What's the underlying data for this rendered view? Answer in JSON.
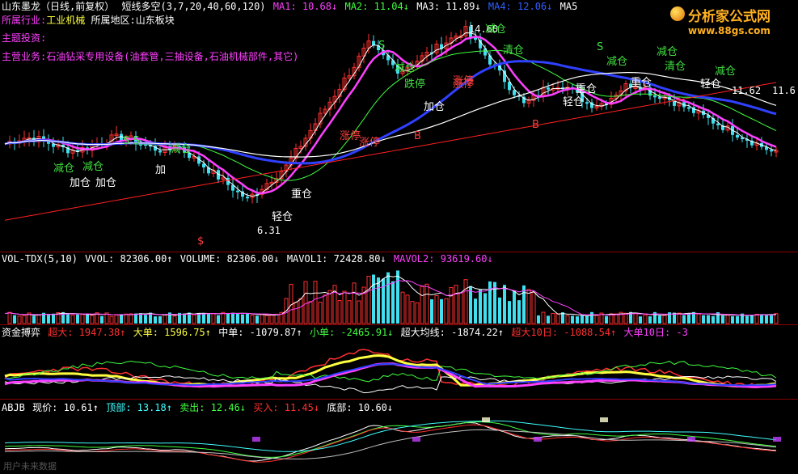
{
  "main_header": {
    "stock": "山东墨龙（日线,前复权）",
    "indicator": "短线多空(3,7,20,40,60,120)",
    "ma1": "MA1: 10.68↓",
    "ma2": "MA2: 11.04↓",
    "ma3": "MA3: 11.89↓",
    "ma4": "MA4: 12.06↓",
    "ma5": "MA5"
  },
  "info_lines": {
    "industry_label": "所属行业:",
    "industry": "工业机械",
    "region_label": "所属地区:",
    "region": "山东板块",
    "theme_label": "主题投资:",
    "business_label": "主营业务:",
    "business": "石油钻采专用设备(油套管,三抽设备,石油机械部件,其它)"
  },
  "price_labels": {
    "high": "14.60",
    "low": "6.31",
    "right_price": "11.62",
    "right_price2": "11.6"
  },
  "signals": [
    {
      "text": "减仓",
      "color": "#40e040"
    },
    {
      "text": "减仓",
      "color": "#40e040"
    },
    {
      "text": "加仓",
      "color": "#ffffff"
    },
    {
      "text": "加仓",
      "color": "#ffffff"
    },
    {
      "text": "加",
      "color": "#ffffff"
    },
    {
      "text": "减仓",
      "color": "#40e040"
    },
    {
      "text": "S S",
      "color": "#40e040"
    },
    {
      "text": "重仓",
      "color": "#ffffff"
    },
    {
      "text": "轻仓",
      "color": "#ffffff"
    },
    {
      "text": "涨停",
      "color": "#ff4040"
    },
    {
      "text": "涨停",
      "color": "#ff4040"
    },
    {
      "text": "减仓",
      "color": "#40e040"
    },
    {
      "text": "S",
      "color": "#40e040"
    },
    {
      "text": "跌停",
      "color": "#40e040"
    },
    {
      "text": "加仓",
      "color": "#ffffff"
    },
    {
      "text": "涨停",
      "color": "#ff4040"
    },
    {
      "text": "B",
      "color": "#ff4040"
    },
    {
      "text": "减仓",
      "color": "#40e040"
    },
    {
      "text": "清仓",
      "color": "#40e040"
    },
    {
      "text": "涨停",
      "color": "#ff4040"
    },
    {
      "text": "轻仓",
      "color": "#ffffff"
    },
    {
      "text": "重仓",
      "color": "#ffffff"
    },
    {
      "text": "减仓",
      "color": "#40e040"
    },
    {
      "text": "S",
      "color": "#40e040"
    },
    {
      "text": "减仓",
      "color": "#40e040"
    },
    {
      "text": "清仓",
      "color": "#40e040"
    },
    {
      "text": "重仓",
      "color": "#ffffff"
    },
    {
      "text": "减仓",
      "color": "#40e040"
    },
    {
      "text": "轻仓",
      "color": "#ffffff"
    },
    {
      "text": "B",
      "color": "#ff4040"
    },
    {
      "text": "$",
      "color": "#ff4040"
    }
  ],
  "vol_header": {
    "name": "VOL-TDX(5,10)",
    "vvol": "VVOL: 82306.00↑",
    "volume": "VOLUME: 82306.00↓",
    "mavol1": "MAVOL1: 72428.80↓",
    "mavol2": "MAVOL2: 93619.60↓"
  },
  "fund_header": {
    "name": "资金搏弈",
    "super": "超大: 1947.38↑",
    "big": "大单: 1596.75↑",
    "mid": "中单: -1079.87↑",
    "small": "小单: -2465.91↓",
    "super_avg": "超大均线: -1874.22↑",
    "super10": "超大10日: -1088.54↑",
    "big10": "大单10日: -3"
  },
  "abjb_header": {
    "name": "ABJB",
    "price": "现价: 10.61↑",
    "top": "顶部: 13.18↑",
    "sell": "卖出: 12.46↓",
    "buy": "买入: 11.45↓",
    "bottom": "底部: 10.60↓"
  },
  "logo": {
    "title": "分析家公式网",
    "url": "www.88gs.com"
  },
  "watermark": "用户未来数据",
  "colors": {
    "up": "#ff3030",
    "down": "#40e0f0",
    "ma_white": "#ffffff",
    "ma_yellow": "#ffff40",
    "ma_magenta": "#ff40ff",
    "ma_green": "#40ff40",
    "ma_blue": "#3040ff",
    "ma_red": "#ff2020",
    "separator": "#8a0000"
  }
}
